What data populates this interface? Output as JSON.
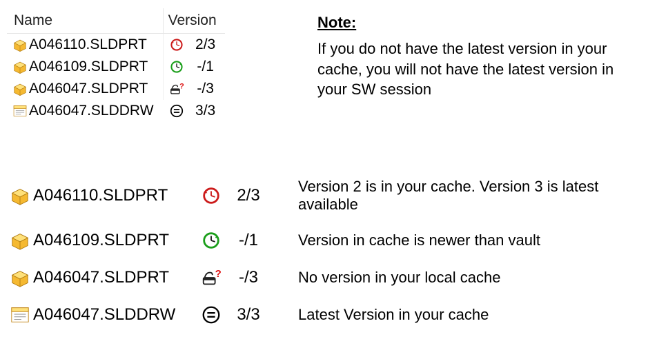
{
  "table": {
    "cols": {
      "name": "Name",
      "version": "Version"
    },
    "rows": [
      {
        "icon": "part",
        "name": "A046110.SLDPRT",
        "status": "old",
        "version": "2/3"
      },
      {
        "icon": "part",
        "name": "A046109.SLDPRT",
        "status": "newer",
        "version": "-/1"
      },
      {
        "icon": "part",
        "name": "A046047.SLDPRT",
        "status": "nocache",
        "version": "-/3"
      },
      {
        "icon": "drawing",
        "name": "A046047.SLDDRW",
        "status": "current",
        "version": "3/3"
      }
    ]
  },
  "note": {
    "heading": "Note:",
    "body": "If you do not have the latest version in your cache, you will not have the latest version in your SW session"
  },
  "legend": [
    {
      "icon": "part",
      "name": "A046110.SLDPRT",
      "status": "old",
      "version": "2/3",
      "desc": "Version 2 is in your cache.  Version 3 is latest available"
    },
    {
      "icon": "part",
      "name": "A046109.SLDPRT",
      "status": "newer",
      "version": "-/1",
      "desc": "Version in cache is newer than vault"
    },
    {
      "icon": "part",
      "name": "A046047.SLDPRT",
      "status": "nocache",
      "version": "-/3",
      "desc": "No version in your local cache"
    },
    {
      "icon": "drawing",
      "name": "A046047.SLDDRW",
      "status": "current",
      "version": "3/3",
      "desc": "Latest Version in your cache"
    }
  ]
}
